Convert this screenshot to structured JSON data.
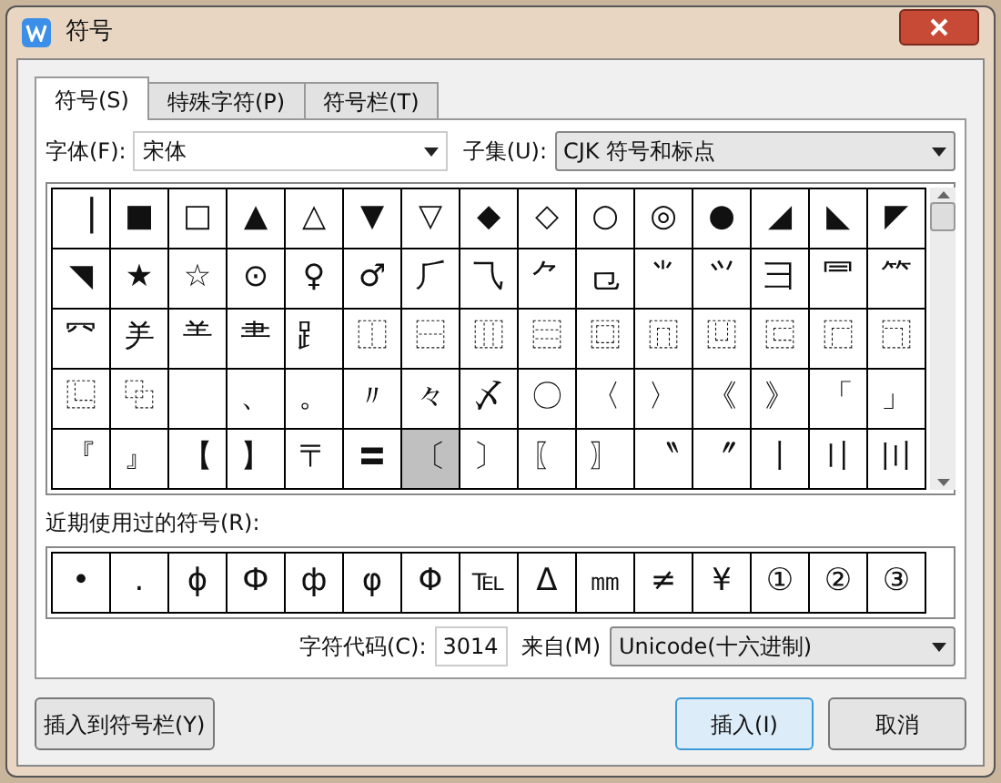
{
  "window": {
    "title": "符号"
  },
  "tabs": [
    {
      "label": "符号(S)",
      "selected": true
    },
    {
      "label": "特殊字符(P)",
      "selected": false
    },
    {
      "label": "符号栏(T)",
      "selected": false
    }
  ],
  "font": {
    "label": "字体(F):",
    "value": "宋体"
  },
  "subset": {
    "label": "子集(U):",
    "value": "CJK 符号和标点"
  },
  "grid": [
    [
      {
        "symbol": "▕",
        "selected": false
      },
      {
        "symbol": "■",
        "selected": false
      },
      {
        "symbol": "□",
        "selected": false
      },
      {
        "symbol": "▲",
        "selected": false
      },
      {
        "symbol": "△",
        "selected": false
      },
      {
        "symbol": "▼",
        "selected": false
      },
      {
        "symbol": "▽",
        "selected": false
      },
      {
        "symbol": "◆",
        "selected": false
      },
      {
        "symbol": "◇",
        "selected": false
      },
      {
        "symbol": "○",
        "selected": false
      },
      {
        "symbol": "◎",
        "selected": false
      },
      {
        "symbol": "●",
        "selected": false
      },
      {
        "symbol": "◢",
        "selected": false
      },
      {
        "symbol": "◣",
        "selected": false
      },
      {
        "symbol": "◤",
        "selected": false
      }
    ],
    [
      {
        "symbol": "◥",
        "selected": false
      },
      {
        "symbol": "★",
        "selected": false
      },
      {
        "symbol": "☆",
        "selected": false
      },
      {
        "symbol": "⊙",
        "selected": false
      },
      {
        "symbol": "♀",
        "selected": false
      },
      {
        "symbol": "♂",
        "selected": false
      },
      {
        "symbol": "⺁",
        "selected": false
      },
      {
        "symbol": "⺄",
        "selected": false
      },
      {
        "symbol": "⺈",
        "selected": false
      },
      {
        "symbol": "⺋",
        "selected": false
      },
      {
        "symbol": "⺌",
        "selected": false
      },
      {
        "symbol": "⺍",
        "selected": false
      },
      {
        "symbol": "⺕",
        "selected": false
      },
      {
        "symbol": "⺜",
        "selected": false
      },
      {
        "symbol": "⺮",
        "selected": false
      }
    ],
    [
      {
        "symbol": "⺳",
        "selected": false
      },
      {
        "symbol": "⺶",
        "selected": false
      },
      {
        "symbol": "⺷",
        "selected": false
      },
      {
        "symbol": "⺻",
        "selected": false
      },
      {
        "symbol": "⻊",
        "selected": false
      },
      {
        "symbol": "⿰",
        "selected": false
      },
      {
        "symbol": "⿱",
        "selected": false
      },
      {
        "symbol": "⿲",
        "selected": false
      },
      {
        "symbol": "⿳",
        "selected": false
      },
      {
        "symbol": "⿴",
        "selected": false
      },
      {
        "symbol": "⿵",
        "selected": false
      },
      {
        "symbol": "⿶",
        "selected": false
      },
      {
        "symbol": "⿷",
        "selected": false
      },
      {
        "symbol": "⿸",
        "selected": false
      },
      {
        "symbol": "⿹",
        "selected": false
      }
    ],
    [
      {
        "symbol": "⿺",
        "selected": false
      },
      {
        "symbol": "⿻",
        "selected": false
      },
      {
        "selected": false
      },
      {
        "symbol": "、",
        "selected": false
      },
      {
        "symbol": "。",
        "selected": false
      },
      {
        "symbol": "〃",
        "selected": false
      },
      {
        "symbol": "々",
        "selected": false
      },
      {
        "symbol": "〆",
        "selected": false
      },
      {
        "symbol": "〇",
        "selected": false
      },
      {
        "symbol": "〈",
        "selected": false
      },
      {
        "symbol": "〉",
        "selected": false
      },
      {
        "symbol": "《",
        "selected": false
      },
      {
        "symbol": "》",
        "selected": false
      },
      {
        "symbol": "「",
        "selected": false
      },
      {
        "symbol": "」",
        "selected": false
      }
    ],
    [
      {
        "symbol": "『",
        "selected": false
      },
      {
        "symbol": "』",
        "selected": false
      },
      {
        "symbol": "【",
        "selected": false
      },
      {
        "symbol": "】",
        "selected": false
      },
      {
        "symbol": "〒",
        "selected": false
      },
      {
        "symbol": "〓",
        "selected": false
      },
      {
        "symbol": "〔",
        "selected": true
      },
      {
        "symbol": "〕",
        "selected": false
      },
      {
        "symbol": "〖",
        "selected": false
      },
      {
        "symbol": "〗",
        "selected": false
      },
      {
        "symbol": "〝",
        "selected": false
      },
      {
        "symbol": "〞",
        "selected": false
      },
      {
        "symbol": "〡",
        "selected": false
      },
      {
        "symbol": "〢",
        "selected": false
      },
      {
        "symbol": "〣",
        "selected": false
      }
    ]
  ],
  "recent": {
    "label": "近期使用过的符号(R):",
    "symbols": [
      "•",
      ".",
      "ɸ",
      "Ф",
      "ф",
      "φ",
      "Φ",
      "℡",
      "Δ",
      "㎜",
      "≠",
      "¥",
      "①",
      "②",
      "③"
    ]
  },
  "code": {
    "label": "字符代码(C):",
    "value": "3014",
    "from_label": "来自(M)",
    "from_value": "Unicode(十六进制)"
  },
  "buttons": {
    "add_to_bar": "插入到符号栏(Y)",
    "insert": "插入(I)",
    "cancel": "取消"
  }
}
